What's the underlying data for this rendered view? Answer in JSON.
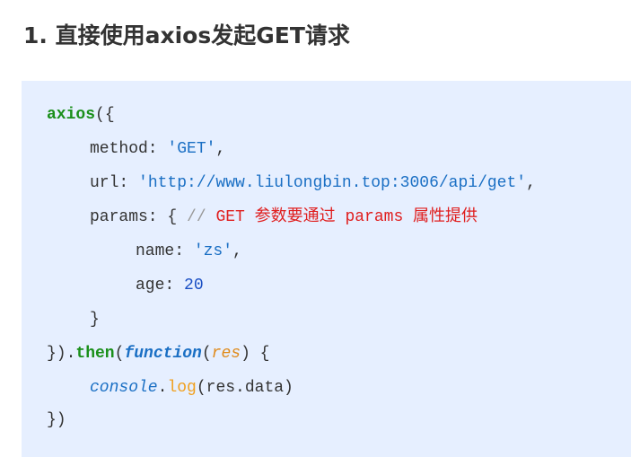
{
  "heading": "1. 直接使用axios发起GET请求",
  "code": {
    "lines": [
      [
        {
          "t": "axios",
          "c": "fn"
        },
        {
          "t": "({",
          "c": "plain"
        }
      ],
      [
        {
          "t": "method: ",
          "c": "plain"
        },
        {
          "t": "'GET'",
          "c": "str"
        },
        {
          "t": ",",
          "c": "plain"
        }
      ],
      [
        {
          "t": "url: ",
          "c": "plain"
        },
        {
          "t": "'http://www.liulongbin.top:3006/api/get'",
          "c": "str"
        },
        {
          "t": ",",
          "c": "plain"
        }
      ],
      [
        {
          "t": "params: { ",
          "c": "plain"
        },
        {
          "t": "// ",
          "c": "comment-slash"
        },
        {
          "t": "GET 参数要通过 params 属性提供",
          "c": "comment"
        }
      ],
      [
        {
          "t": "name: ",
          "c": "plain"
        },
        {
          "t": "'zs'",
          "c": "str"
        },
        {
          "t": ",",
          "c": "plain"
        }
      ],
      [
        {
          "t": "age: ",
          "c": "plain"
        },
        {
          "t": "20",
          "c": "num"
        }
      ],
      [
        {
          "t": "}",
          "c": "plain"
        }
      ],
      [
        {
          "t": "}).",
          "c": "plain"
        },
        {
          "t": "then",
          "c": "fn"
        },
        {
          "t": "(",
          "c": "plain"
        },
        {
          "t": "function",
          "c": "kw"
        },
        {
          "t": "(",
          "c": "plain"
        },
        {
          "t": "res",
          "c": "param"
        },
        {
          "t": ") {",
          "c": "plain"
        }
      ],
      [
        {
          "t": "console",
          "c": "builtin"
        },
        {
          "t": ".",
          "c": "plain"
        },
        {
          "t": "log",
          "c": "method"
        },
        {
          "t": "(res.data)",
          "c": "plain"
        }
      ],
      [
        {
          "t": "})",
          "c": "plain"
        }
      ]
    ]
  }
}
